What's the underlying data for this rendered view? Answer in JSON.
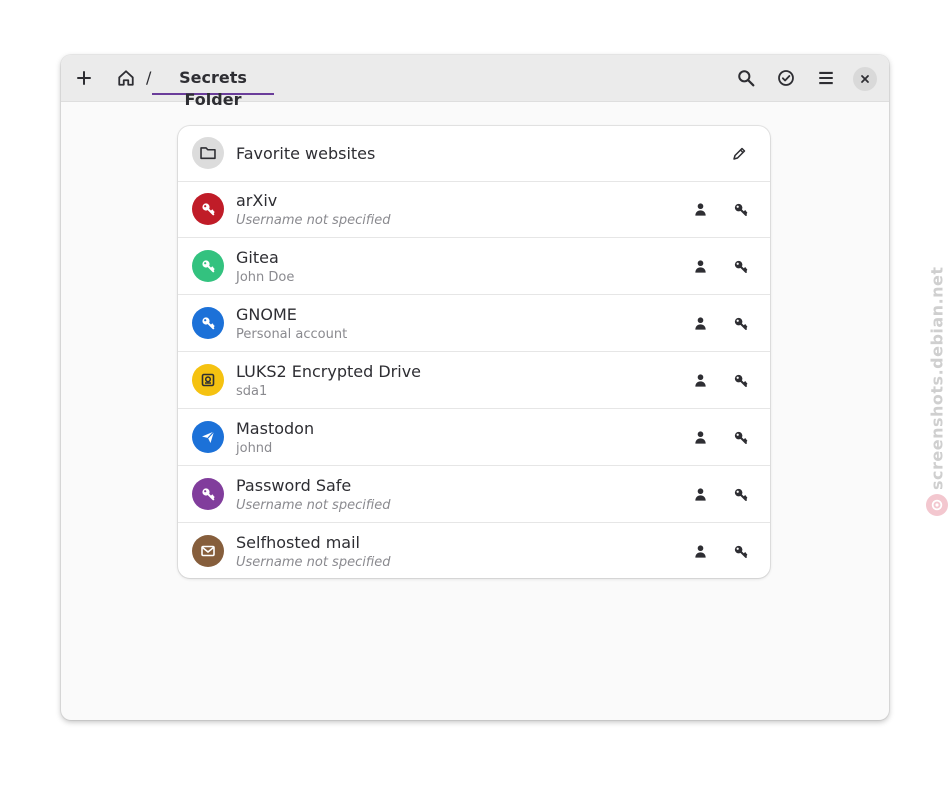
{
  "header": {
    "breadcrumb_separator": "/",
    "current_folder": "Secrets Folder",
    "icons": {
      "new": "plus-icon",
      "home": "home-icon",
      "search": "search-icon",
      "select": "check-circle-icon",
      "menu": "hamburger-menu-icon",
      "close": "close-icon"
    }
  },
  "folder": {
    "title": "Favorite websites",
    "icon": "folder-icon",
    "edit_icon": "pencil-icon"
  },
  "items": [
    {
      "title": "arXiv",
      "subtitle": "Username not specified",
      "subtitle_italic": true,
      "color": "#c01c28",
      "icon": "key-icon"
    },
    {
      "title": "Gitea",
      "subtitle": "John Doe",
      "subtitle_italic": false,
      "color": "#33c27f",
      "icon": "key-icon"
    },
    {
      "title": "GNOME",
      "subtitle": "Personal account",
      "subtitle_italic": false,
      "color": "#1c71d8",
      "icon": "key-icon"
    },
    {
      "title": "LUKS2 Encrypted Drive",
      "subtitle": "sda1",
      "subtitle_italic": false,
      "color": "#f5c211",
      "icon": "drive-icon"
    },
    {
      "title": "Mastodon",
      "subtitle": "johnd",
      "subtitle_italic": false,
      "color": "#1c71d8",
      "icon": "send-icon"
    },
    {
      "title": "Password Safe",
      "subtitle": "Username not specified",
      "subtitle_italic": true,
      "color": "#813d9c",
      "icon": "key-icon"
    },
    {
      "title": "Selfhosted mail",
      "subtitle": "Username not specified",
      "subtitle_italic": true,
      "color": "#865e3c",
      "icon": "mail-icon"
    }
  ],
  "row_actions": {
    "copy_username_icon": "person-icon",
    "copy_password_icon": "key-icon"
  },
  "watermark": {
    "text": "screenshots.debian.net"
  }
}
